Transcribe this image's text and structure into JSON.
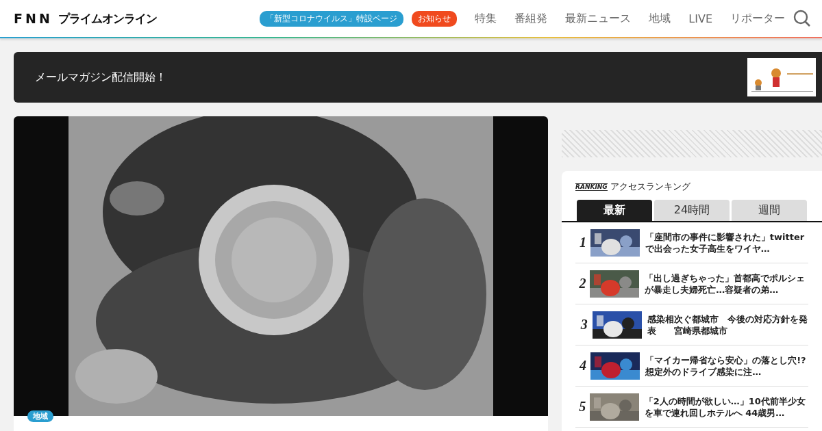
{
  "header": {
    "logo": {
      "mark": "FNN",
      "name": "プライムオンライン"
    },
    "pills": [
      {
        "label": "「新型コロナウイルス」特設ページ",
        "kind": "special"
      },
      {
        "label": "お知らせ",
        "kind": "notice"
      }
    ],
    "nav": [
      "特集",
      "番組発",
      "最新ニュース",
      "地域",
      "LIVE",
      "リポーター"
    ]
  },
  "banner": {
    "text": "メールマガジン配信開始！"
  },
  "article": {
    "category": "地域"
  },
  "ranking": {
    "badge": "RANKING",
    "title": "アクセスランキング",
    "tabs": [
      {
        "label": "最新",
        "selected": true
      },
      {
        "label": "24時間",
        "selected": false
      },
      {
        "label": "週間",
        "selected": false
      }
    ],
    "items": [
      {
        "rank": "1",
        "title": "「座間市の事件に影響された」twitterで出会った女子高生をワイヤ…"
      },
      {
        "rank": "2",
        "title": "「出し過ぎちゃった」首都高でポルシェが暴走し夫婦死亡…容疑者の弟…"
      },
      {
        "rank": "3",
        "title": "感染相次ぐ都城市　今後の対応方針を発表　　宮崎県都城市"
      },
      {
        "rank": "4",
        "title": "「マイカー帰省なら安心」の落とし穴!? 想定外のドライブ感染に注…"
      },
      {
        "rank": "5",
        "title": "「2人の時間が欲しい…」10代前半少女を車で連れ回しホテルへ 44歳男…"
      }
    ]
  }
}
